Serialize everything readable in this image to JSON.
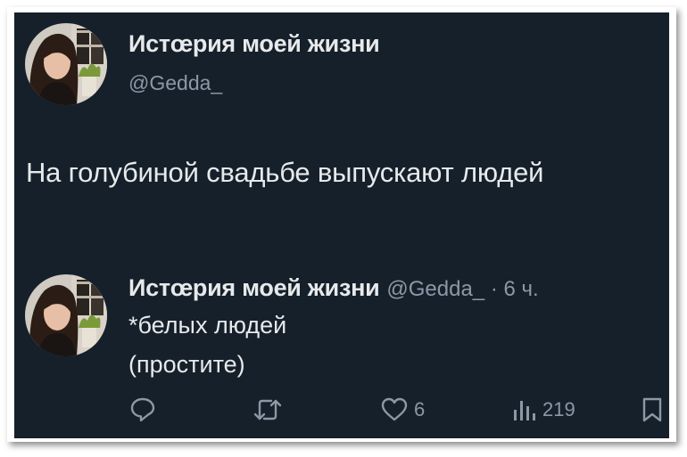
{
  "tweet": {
    "author_name": "Истœрия моей жизни",
    "author_handle": "@Gedda_",
    "text": "На голубиной свадьбе выпускают людей"
  },
  "reply": {
    "author_name": "Истœрия моей жизни",
    "meta": "@Gedda_ · 6 ч.",
    "line1": "*белых людей",
    "line2": "(простите)"
  },
  "actions": {
    "likes": "6",
    "views": "219"
  },
  "icons": {
    "reply": "reply-icon",
    "retweet": "retweet-icon",
    "like": "heart-icon",
    "views": "views-icon",
    "bookmark": "bookmark-icon"
  },
  "colors": {
    "background": "#15202b",
    "text": "#e7e9ea",
    "secondary": "#8b98a5"
  }
}
